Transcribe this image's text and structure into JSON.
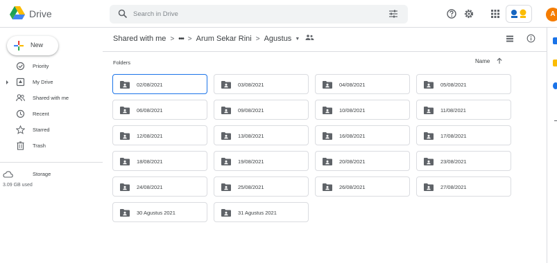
{
  "app": {
    "title": "Drive"
  },
  "search": {
    "placeholder": "Search in Drive"
  },
  "account": {
    "avatar_letter": "A"
  },
  "sidebar": {
    "new_label": "New",
    "items": [
      {
        "label": "Priority",
        "icon": "priority-icon"
      },
      {
        "label": "My Drive",
        "icon": "my-drive-icon"
      },
      {
        "label": "Shared with me",
        "icon": "shared-icon"
      },
      {
        "label": "Recent",
        "icon": "clock-icon"
      },
      {
        "label": "Starred",
        "icon": "star-icon"
      },
      {
        "label": "Trash",
        "icon": "trash-icon"
      },
      {
        "label": "Storage",
        "icon": "cloud-icon"
      }
    ],
    "storage_used": "3.09 GB used"
  },
  "breadcrumb": {
    "root": "Shared with me",
    "overflow": "•••",
    "parent": "Arum Sekar Rini",
    "current": "Agustus",
    "separator": ">",
    "caret": "▼"
  },
  "main": {
    "folders_heading": "Folders",
    "sort_label": "Name"
  },
  "folders": [
    "02/08/2021",
    "03/08/2021",
    "04/08/2021",
    "05/08/2021",
    "06/08/2021",
    "09/08/2021",
    "10/08/2021",
    "11/08/2021",
    "12/08/2021",
    "13/08/2021",
    "16/08/2021",
    "17/08/2021",
    "18/08/2021",
    "19/08/2021",
    "20/08/2021",
    "23/08/2021",
    "24/08/2021",
    "25/08/2021",
    "26/08/2021",
    "27/08/2021",
    "30 Agustus 2021",
    "31 Agustus 2021"
  ],
  "colors": {
    "accent": "#1a73e8",
    "folder_icon": "#5f6368",
    "avatar": "#f57c00"
  }
}
